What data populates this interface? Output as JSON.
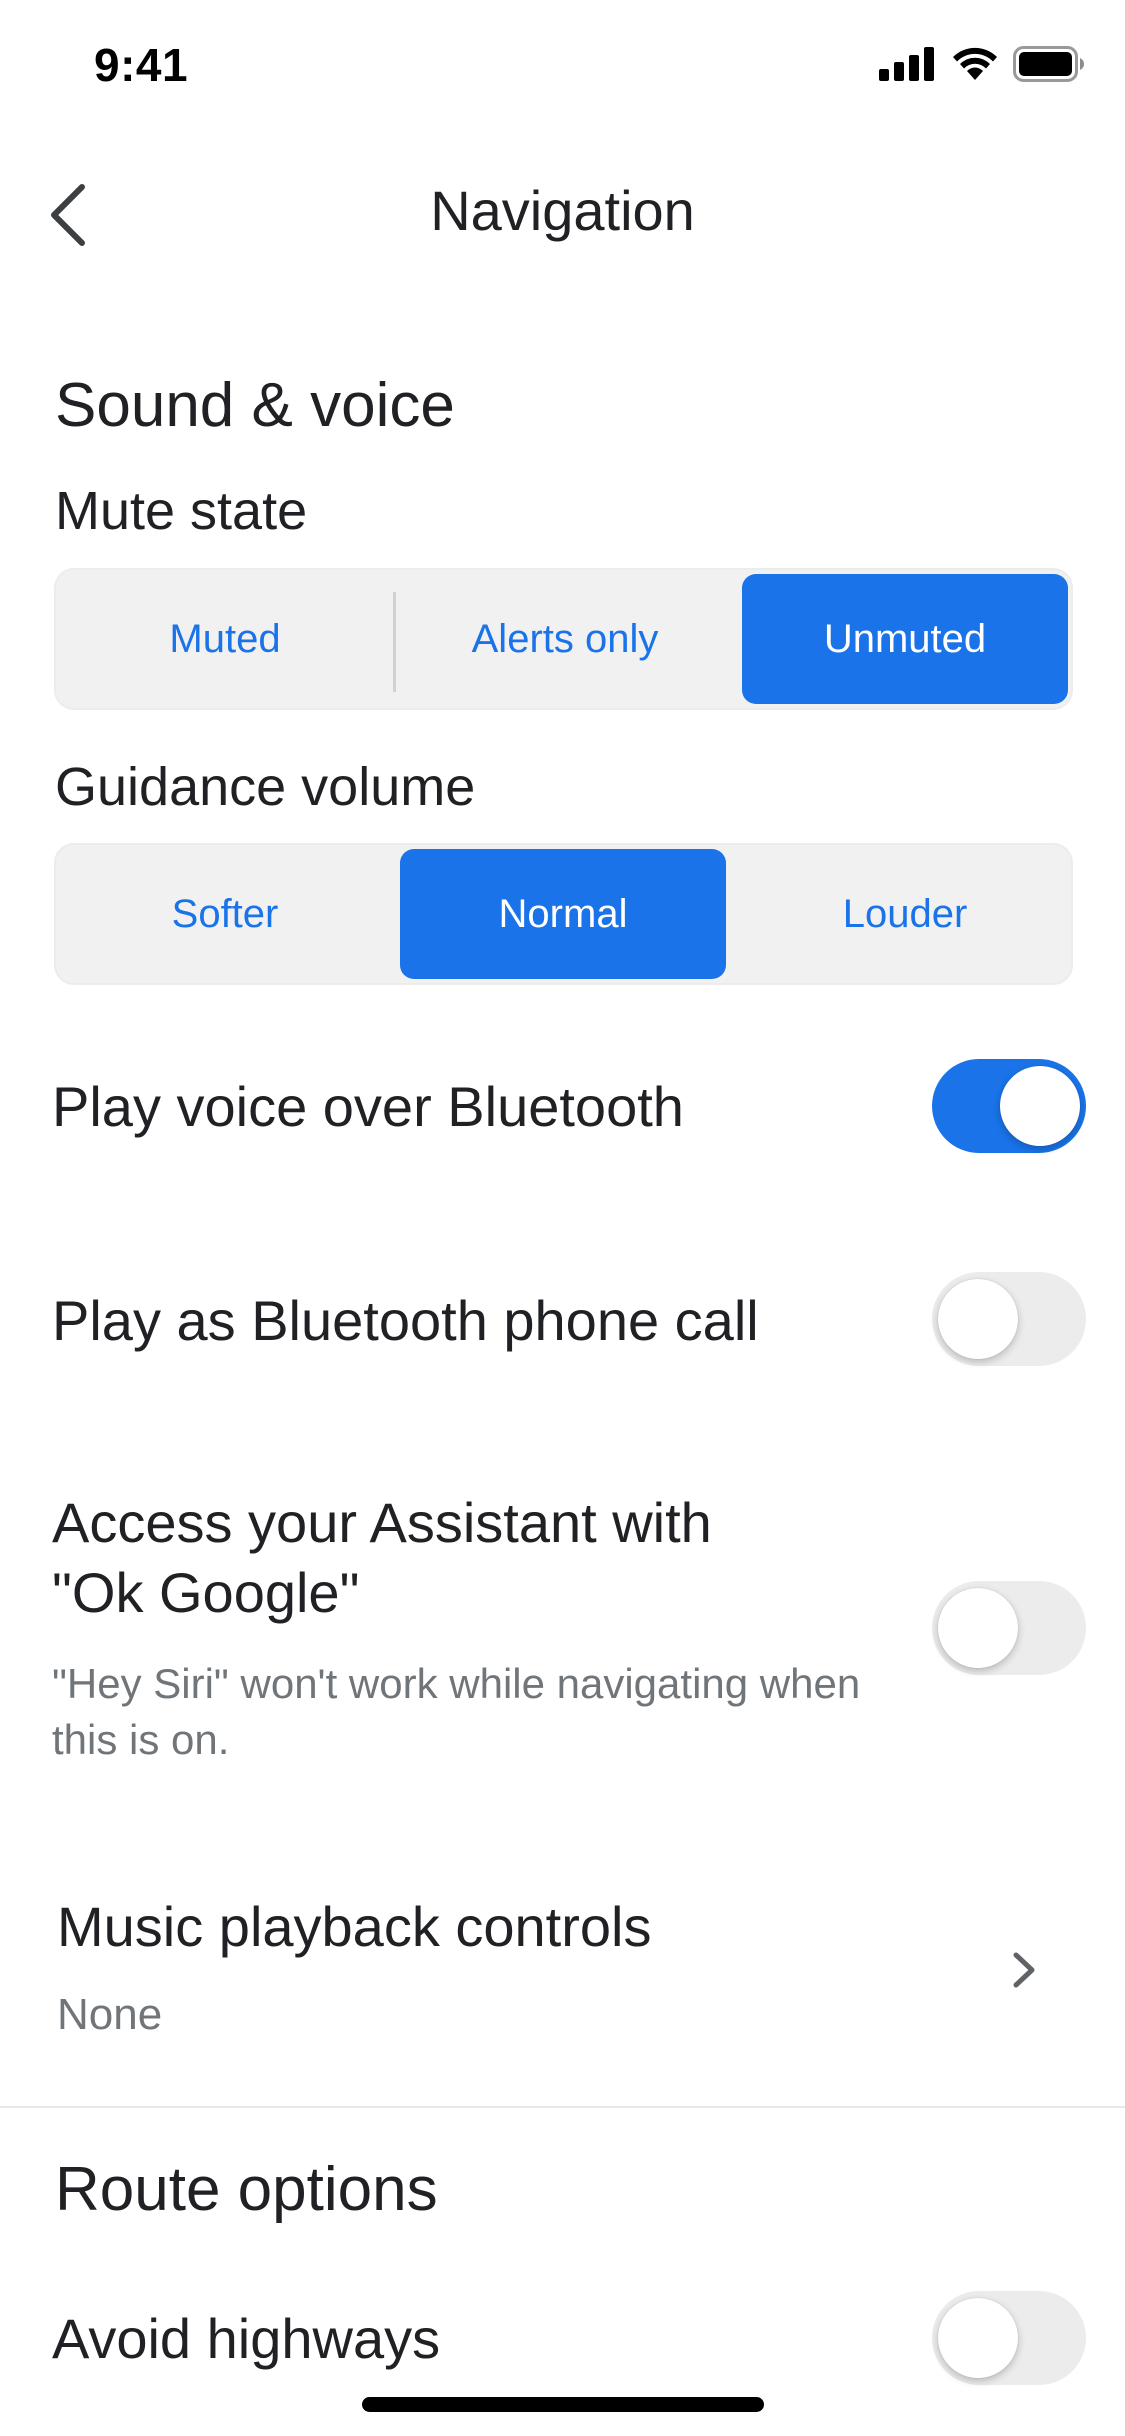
{
  "status_bar": {
    "time": "9:41",
    "icons": [
      "cellular-signal-icon",
      "wifi-icon",
      "battery-icon"
    ]
  },
  "header": {
    "title": "Navigation",
    "back_icon": "chevron-left-icon"
  },
  "sound_voice": {
    "heading": "Sound & voice",
    "mute_state": {
      "label": "Mute state",
      "options": [
        "Muted",
        "Alerts only",
        "Unmuted"
      ],
      "selected": "Unmuted"
    },
    "guidance_volume": {
      "label": "Guidance volume",
      "options": [
        "Softer",
        "Normal",
        "Louder"
      ],
      "selected": "Normal"
    },
    "play_bluetooth": {
      "label": "Play voice over Bluetooth",
      "enabled": true
    },
    "play_phone_call": {
      "label": "Play as Bluetooth phone call",
      "enabled": false
    },
    "ok_google": {
      "label_line1": "Access your Assistant with",
      "label_line2": "\"Ok Google\"",
      "description": "\"Hey Siri\" won't work while navigating when this is on.",
      "enabled": false
    },
    "music_controls": {
      "label": "Music playback controls",
      "value": "None",
      "chevron_icon": "chevron-right-icon"
    }
  },
  "route_options": {
    "heading": "Route options",
    "avoid_highways": {
      "label": "Avoid highways",
      "enabled": false
    }
  },
  "colors": {
    "accent": "#1a73e8",
    "toggle_off": "#ececec",
    "segment_bg": "#f1f1f1",
    "secondary_text": "#70757a"
  }
}
